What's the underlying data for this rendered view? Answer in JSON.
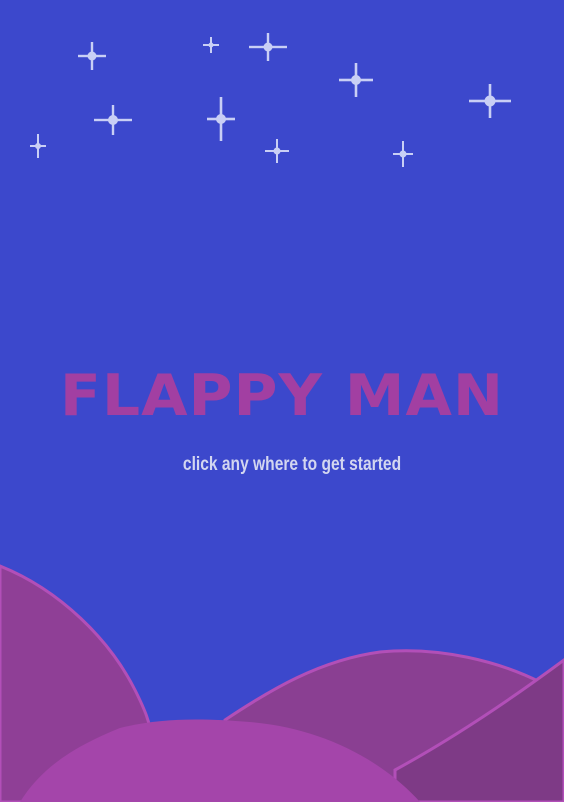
{
  "game": {
    "title": "FLAPPY MAN",
    "prompt": "click any where to get started"
  },
  "colors": {
    "sky": "#3c48cc",
    "title": "#a23fa2",
    "prompt": "#d3d6f0",
    "star": "#c9cff5",
    "hill_back_left": "#8f3f96",
    "hill_back_right": "#8a3f92",
    "hill_far_right": "#7e3a86",
    "hill_front": "#a445aa",
    "hill_outline": "#b24fb8"
  }
}
